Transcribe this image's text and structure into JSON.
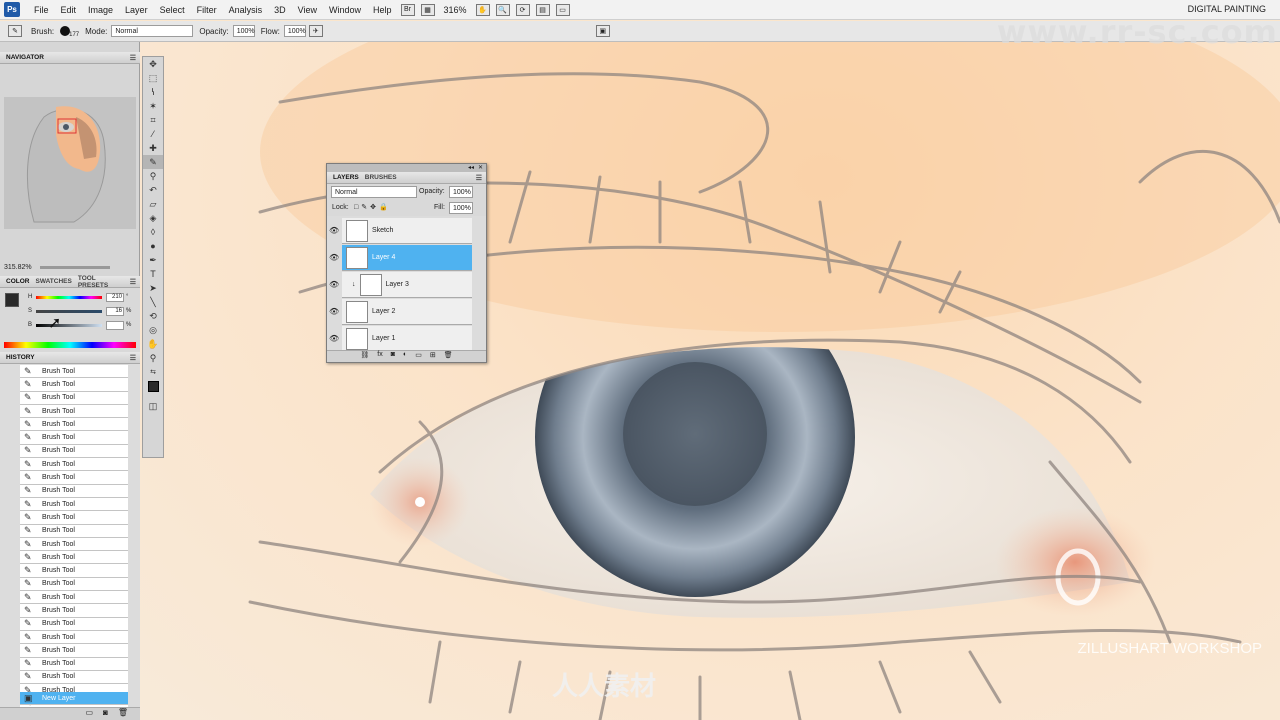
{
  "menubar": {
    "logo": "Ps",
    "items": [
      "File",
      "Edit",
      "Image",
      "Layer",
      "Select",
      "Filter",
      "Analysis",
      "3D",
      "View",
      "Window",
      "Help"
    ],
    "br_label": "Br",
    "zoom": "316%",
    "workspace": "DIGITAL PAINTING"
  },
  "options": {
    "brush_label": "Brush:",
    "brush_size": "177",
    "mode_label": "Mode:",
    "mode_value": "Normal",
    "opacity_label": "Opacity:",
    "opacity_value": "100%",
    "flow_label": "Flow:",
    "flow_value": "100%"
  },
  "navigator": {
    "title": "NAVIGATOR",
    "zoom": "315.82%"
  },
  "color_panel": {
    "tabs": [
      "COLOR",
      "SWATCHES",
      "TOOL PRESETS"
    ],
    "h_label": "H",
    "h_value": "210",
    "h_unit": "°",
    "s_label": "S",
    "s_value": "16",
    "s_unit": "%",
    "b_label": "B",
    "b_value": "",
    "b_unit": "%",
    "foreground_color": "#2a2a2a"
  },
  "history": {
    "title": "HISTORY",
    "items": [
      "Brush Tool",
      "Brush Tool",
      "Brush Tool",
      "Brush Tool",
      "Brush Tool",
      "Brush Tool",
      "Brush Tool",
      "Brush Tool",
      "Brush Tool",
      "Brush Tool",
      "Brush Tool",
      "Brush Tool",
      "Brush Tool",
      "Brush Tool",
      "Brush Tool",
      "Brush Tool",
      "Brush Tool",
      "Brush Tool",
      "Brush Tool",
      "Brush Tool",
      "Brush Tool",
      "Brush Tool",
      "Brush Tool",
      "Brush Tool",
      "Brush Tool",
      "Brush Tool"
    ],
    "active_item": "New Layer"
  },
  "layers": {
    "tabs": [
      "LAYERS",
      "BRUSHES"
    ],
    "blend_mode": "Normal",
    "opacity_label": "Opacity:",
    "opacity_value": "100%",
    "lock_label": "Lock:",
    "fill_label": "Fill:",
    "fill_value": "100%",
    "rows": [
      "Sketch",
      "Layer 4",
      "Layer 3",
      "Layer 2",
      "Layer 1"
    ],
    "selected": "Layer 4",
    "accent": "#4fb2f0"
  },
  "watermarks": {
    "site": "www.rr-sc.com",
    "workshop": "ZILLUSHART WORKSHOP",
    "logo_text": "人人素材"
  }
}
